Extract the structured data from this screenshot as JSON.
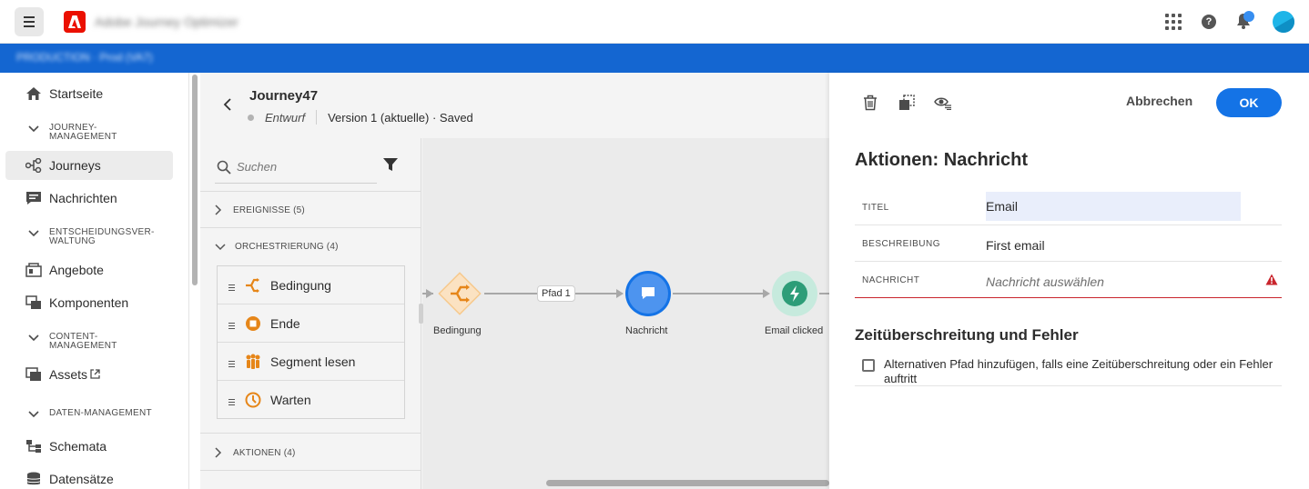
{
  "app": {
    "title": "Adobe Journey Optimizer",
    "org_switcher": "PRODUCTION · Prod (VA7)"
  },
  "nav": {
    "items": [
      {
        "key": "home",
        "label": "Startseite"
      },
      {
        "key": "journeys",
        "label": "Journeys"
      },
      {
        "key": "messages",
        "label": "Nachrichten"
      },
      {
        "key": "offers",
        "label": "Angebote"
      },
      {
        "key": "components",
        "label": "Komponenten"
      },
      {
        "key": "assets",
        "label": "Assets"
      },
      {
        "key": "schemas",
        "label": "Schemata"
      },
      {
        "key": "datasets",
        "label": "Datensätze"
      }
    ],
    "sections": [
      {
        "label_line1": "JOURNEY-",
        "label_line2": "MANAGEMENT"
      },
      {
        "label_line1": "ENTSCHEIDUNGSVER-",
        "label_line2": "WALTUNG"
      },
      {
        "label_line1": "CONTENT-",
        "label_line2": "MANAGEMENT"
      },
      {
        "label_line1": "DATEN-MANAGEMENT",
        "label_line2": ""
      }
    ]
  },
  "journey": {
    "name": "Journey47",
    "status": "Entwurf",
    "version": "Version 1 (aktuelle) · Saved"
  },
  "palette": {
    "search_placeholder": "Suchen",
    "categories": {
      "events": "EREIGNISSE (5)",
      "orchestration": "ORCHESTRIERUNG (4)",
      "actions": "AKTIONEN (4)"
    },
    "orchestration_items": [
      {
        "label": "Bedingung",
        "icon": "condition-icon"
      },
      {
        "label": "Ende",
        "icon": "end-icon"
      },
      {
        "label": "Segment lesen",
        "icon": "read-segment-icon"
      },
      {
        "label": "Warten",
        "icon": "wait-icon"
      }
    ]
  },
  "canvas": {
    "nodes": [
      {
        "label": "Bedingung",
        "icon": "condition-icon"
      },
      {
        "label": "Nachricht",
        "icon": "message-icon"
      },
      {
        "label": "Email clicked",
        "icon": "event-icon"
      }
    ],
    "path_label": "Pfad 1"
  },
  "panel": {
    "cancel_label": "Abbrechen",
    "ok_label": "OK",
    "title": "Aktionen: Nachricht",
    "fields": {
      "title_key": "TITEL",
      "title_value": "Email",
      "description_key": "BESCHREIBUNG",
      "description_value": "First email",
      "message_key": "NACHRICHT",
      "message_placeholder": "Nachricht auswählen"
    },
    "timeout_section_title": "Zeitüberschreitung und Fehler",
    "timeout_checkbox_label": "Alternativen Pfad hinzufügen, falls eine Zeitüberschreitung oder ein Fehler auftritt",
    "colors": {
      "accent": "#1473e6",
      "error": "#c9252d",
      "orange": "#e68619",
      "message_node": "#378ef0",
      "event_node": "#2d9d78"
    }
  }
}
